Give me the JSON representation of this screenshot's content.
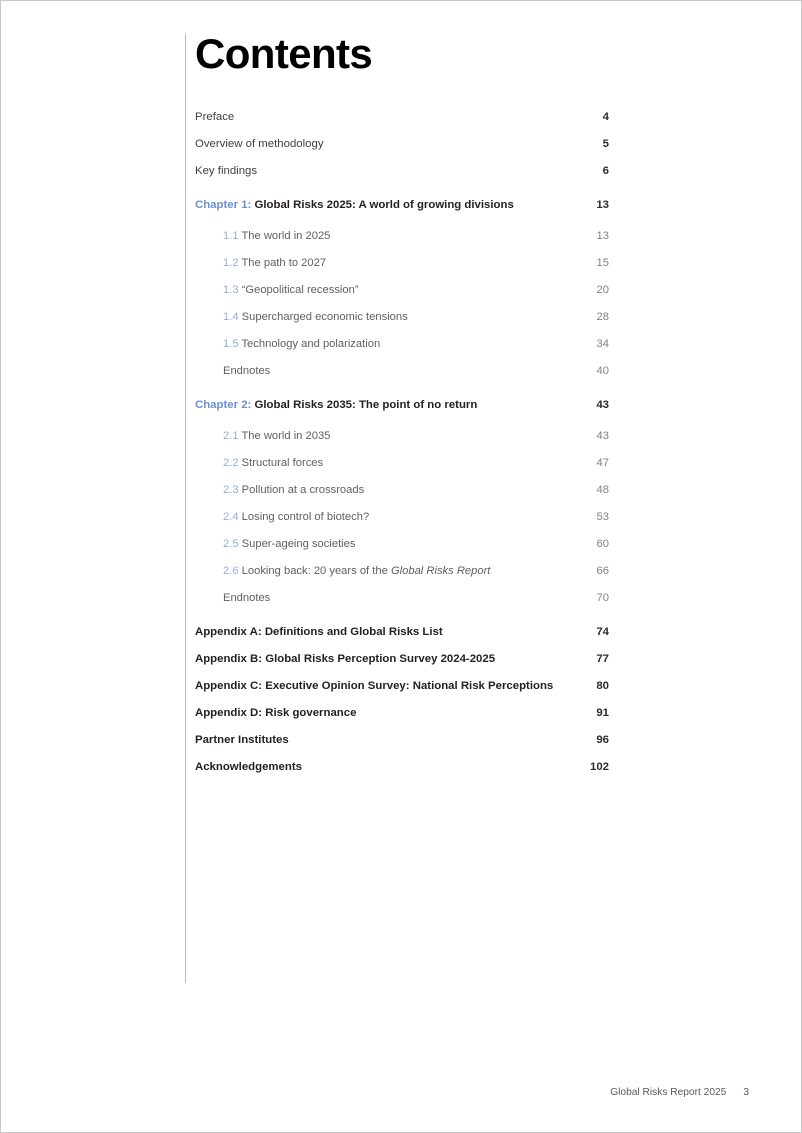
{
  "page": {
    "title": "Contents",
    "accent_blue": "#6b8fd4",
    "sub_blue": "#8fafdf",
    "rule_color": "#b9bcc0"
  },
  "toc": [
    {
      "style": "top",
      "number": "",
      "label": "Preface",
      "page": "4"
    },
    {
      "style": "top",
      "number": "",
      "label": "Overview of methodology",
      "page": "5"
    },
    {
      "style": "top",
      "number": "",
      "label": "Key findings",
      "page": "6"
    },
    {
      "style": "chapter",
      "tag": "Chapter 1:",
      "label": "Global Risks 2025: A world of growing divisions",
      "page": "13"
    },
    {
      "style": "sub",
      "number": "1.1",
      "label": "The world in 2025",
      "page": "13"
    },
    {
      "style": "sub",
      "number": "1.2",
      "label": "The path to 2027",
      "page": "15"
    },
    {
      "style": "sub",
      "number": "1.3",
      "label": "“Geopolitical recession”",
      "page": "20"
    },
    {
      "style": "sub",
      "number": "1.4",
      "label": "Supercharged economic tensions",
      "page": "28"
    },
    {
      "style": "sub",
      "number": "1.5",
      "label": "Technology and polarization",
      "page": "34"
    },
    {
      "style": "endnote",
      "number": "",
      "label": "Endnotes",
      "page": "40"
    },
    {
      "style": "chapter",
      "tag": "Chapter 2:",
      "label": "Global Risks 2035: The point of no return",
      "page": "43"
    },
    {
      "style": "sub",
      "number": "2.1",
      "label": "The world in 2035",
      "page": "43"
    },
    {
      "style": "sub",
      "number": "2.2",
      "label": "Structural forces",
      "page": "47"
    },
    {
      "style": "sub",
      "number": "2.3",
      "label": "Pollution at a crossroads",
      "page": "48"
    },
    {
      "style": "sub",
      "number": "2.4",
      "label": "Losing control of biotech?",
      "page": "53"
    },
    {
      "style": "sub",
      "number": "2.5",
      "label": "Super-ageing societies",
      "page": "60"
    },
    {
      "style": "sub",
      "number": "2.6",
      "label": "Looking back: 20 years of the ",
      "label_italic": "Global Risks Report",
      "page": "66"
    },
    {
      "style": "endnote",
      "number": "",
      "label": "Endnotes",
      "page": "70"
    },
    {
      "style": "appendix",
      "number": "",
      "label": "Appendix A: Definitions and Global Risks List",
      "page": "74"
    },
    {
      "style": "appendix",
      "number": "",
      "label": "Appendix B: Global Risks Perception Survey 2024-2025",
      "page": "77"
    },
    {
      "style": "appendix",
      "number": "",
      "label": "Appendix C: Executive Opinion Survey: National Risk Perceptions",
      "page": "80"
    },
    {
      "style": "appendix",
      "number": "",
      "label": "Appendix D: Risk governance",
      "page": "91"
    },
    {
      "style": "appendix",
      "number": "",
      "label": "Partner Institutes",
      "page": "96"
    },
    {
      "style": "appendix",
      "number": "",
      "label": "Acknowledgements",
      "page": "102"
    }
  ],
  "footer": {
    "document_title": "Global Risks Report 2025",
    "page_number": "3"
  }
}
